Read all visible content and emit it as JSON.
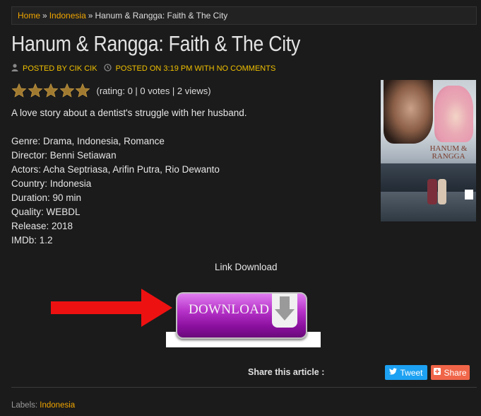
{
  "breadcrumb": {
    "home": "Home",
    "sep1": "»",
    "category": "Indonesia",
    "sep2": "»",
    "current": "Hanum & Rangga: Faith & The City"
  },
  "post": {
    "title": "Hanum & Rangga: Faith & The City",
    "posted_by": "POSTED BY CIK CIK",
    "posted_on": "POSTED ON 3:19 PM WITH NO COMMENTS",
    "rating_text": "(rating: 0 | 0 votes | 2 views)",
    "stars": 5,
    "description": "A love story about a dentist's struggle with her husband.",
    "details": [
      "Genre: Drama, Indonesia, Romance",
      "Director: Benni Setiawan",
      "Actors: Acha Septriasa, Arifin Putra, Rio Dewanto",
      "Country: Indonesia",
      "Duration: 90 min",
      "Quality: WEBDL",
      "Release: 2018",
      "IMDb: 1.2"
    ],
    "poster_title": "HANUM & RANGGA"
  },
  "download": {
    "link_label": "Link Download",
    "button_label": "DOWNLOAD"
  },
  "share": {
    "label": "Share this article :",
    "tweet": "Tweet",
    "share": "Share"
  },
  "labels": {
    "prefix": "Labels:",
    "tag": "Indonesia"
  },
  "colors": {
    "link": "#f0a500",
    "meta": "#f0c000",
    "tweet": "#1da1f2",
    "share": "#f06548",
    "arrow": "#ee1111"
  }
}
